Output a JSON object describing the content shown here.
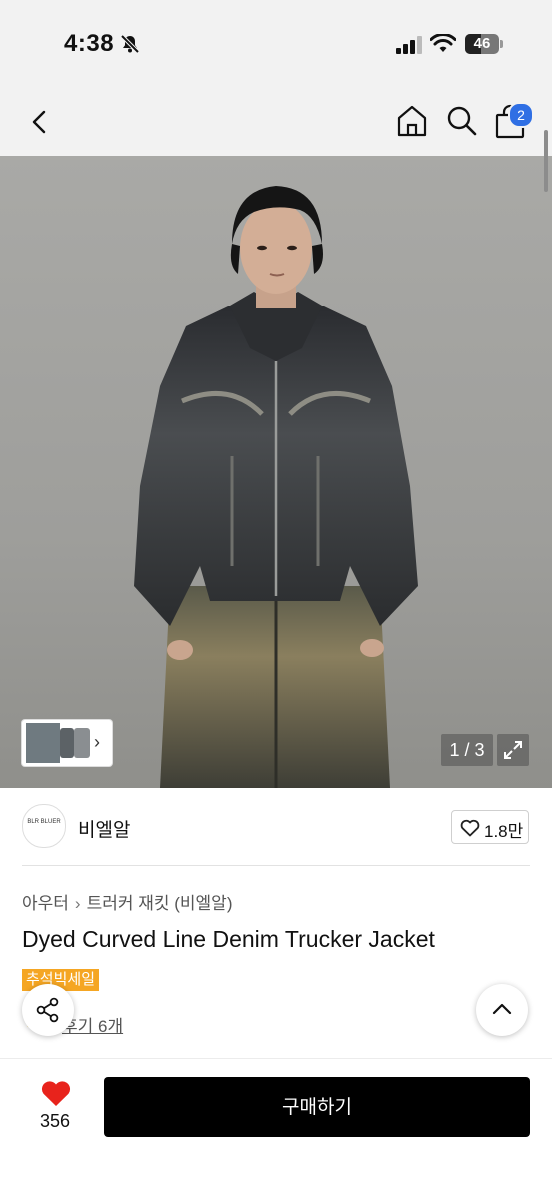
{
  "status_bar": {
    "time": "4:38",
    "battery": "46"
  },
  "nav": {
    "cart_count": "2"
  },
  "gallery": {
    "counter": "1 / 3"
  },
  "brand": {
    "logo_text": "BLR BLUER",
    "name": "비엘알",
    "likes": "1.8만"
  },
  "breadcrumb": {
    "category": "아우터",
    "subcategory": "트러커 재킷 (비엘알)"
  },
  "product": {
    "title": "Dyed Curved Line Denim Trucker Jacket",
    "badge": "추석빅세일",
    "review_text": "후기 6개"
  },
  "bottom": {
    "wish_count": "356",
    "buy_label": "구매하기"
  },
  "colors": {
    "accent": "#2f6fe4",
    "sale": "#f5a623",
    "heart": "#e8231c",
    "buy_button": "#000000"
  },
  "icons": [
    "bell-off-icon",
    "signal-icon",
    "wifi-icon",
    "battery-icon",
    "back-icon",
    "home-icon",
    "search-icon",
    "bag-icon",
    "expand-icon",
    "heart-outline-icon",
    "share-icon",
    "chevron-up-icon",
    "heart-filled-icon",
    "chevron-right-icon"
  ]
}
